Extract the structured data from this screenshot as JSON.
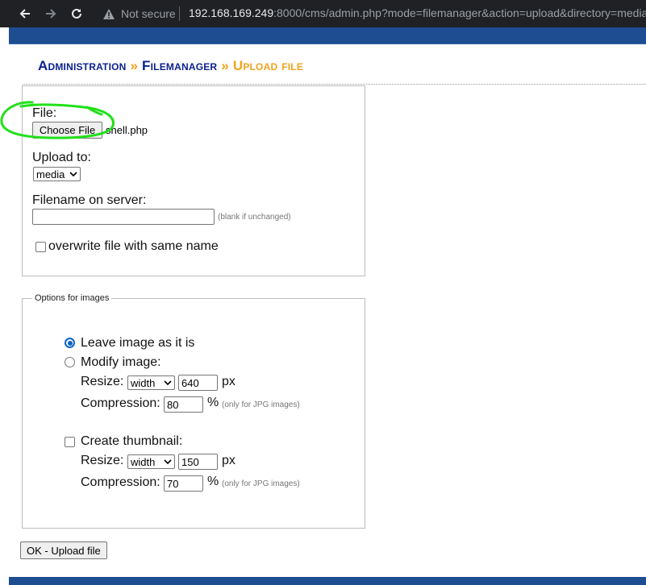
{
  "browser": {
    "security_label": "Not secure",
    "url_host": "192.168.169.249",
    "url_rest": ":8000/cms/admin.php?mode=filemanager&action=upload&directory=media"
  },
  "breadcrumb": {
    "item1": "Administration",
    "sep": "»",
    "item2": "Filemanager",
    "current": "Upload file"
  },
  "file_section": {
    "file_label": "File:",
    "choose_button": "Choose File",
    "chosen_file": "shell.php",
    "upload_to_label": "Upload to:",
    "upload_to_value": "media",
    "filename_label": "Filename on server:",
    "filename_value": "",
    "filename_hint": "(blank if unchanged)",
    "overwrite_label": "overwrite file with same name"
  },
  "image_options": {
    "legend": "Options for images",
    "leave_label": "Leave image as it is",
    "modify_label": "Modify image:",
    "resize_label": "Resize:",
    "resize_mode": "width",
    "resize_value": "640",
    "px": "px",
    "compression_label": "Compression:",
    "compression_value": "80",
    "percent": "%",
    "jpg_hint": "(only for JPG images)",
    "thumbnail_label": "Create thumbnail:",
    "thumb_resize_mode": "width",
    "thumb_resize_value": "150",
    "thumb_compression_value": "70"
  },
  "submit_label": "OK - Upload file",
  "colors": {
    "heading_blue": "#0a1f8f",
    "heading_orange": "#f0a21b",
    "bar_blue": "#1f4d91",
    "annotation_green": "#22e01a"
  }
}
